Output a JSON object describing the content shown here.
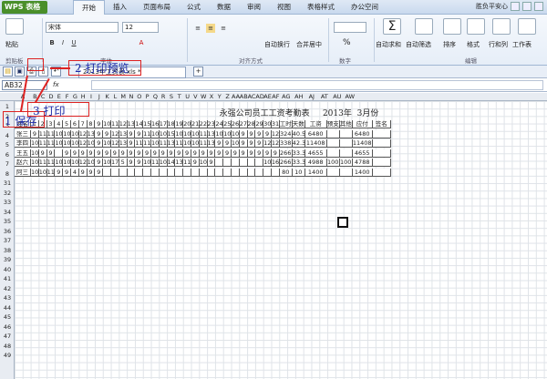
{
  "app": {
    "name": "WPS 表格"
  },
  "menu": [
    "开始",
    "插入",
    "页面布局",
    "公式",
    "数据",
    "审阅",
    "视图",
    "表格样式",
    "办公空间"
  ],
  "user": "胜负平安心",
  "ribbon": {
    "paste": "粘贴",
    "clipboard": "剪贴板",
    "font_name": "宋体",
    "font_size": "12",
    "font_group": "字体",
    "align_group": "对齐方式",
    "wrap": "自动换行",
    "merge": "合并居中",
    "number_group": "数字",
    "percent": "%",
    "autosum": "自动求和",
    "autofilter": "自动筛选",
    "sort": "排序",
    "format": "格式",
    "rowcol": "行和列",
    "worksheet": "工作表",
    "edit_group": "编辑"
  },
  "quickbar": {
    "file_tab": "2013年工资表.xls *",
    "plus": "+"
  },
  "formula": {
    "namebox": "AB32",
    "fx": "fx"
  },
  "columns": [
    "A",
    "B",
    "C",
    "D",
    "E",
    "F",
    "G",
    "H",
    "I",
    "J",
    "K",
    "L",
    "M",
    "N",
    "O",
    "P",
    "Q",
    "R",
    "S",
    "T",
    "U",
    "V",
    "W",
    "X",
    "Y",
    "Z",
    "AA",
    "AB",
    "AC",
    "AD",
    "AE",
    "AF",
    "AG",
    "AH",
    "AJ",
    "AT",
    "AU",
    "AW"
  ],
  "rows": [
    "1",
    "2",
    "3",
    "4",
    "5",
    "6",
    "7",
    "8",
    "31",
    "32",
    "33",
    "34",
    "35",
    "36",
    "37",
    "38",
    "39",
    "40",
    "41",
    "42",
    "43",
    "44",
    "45",
    "46",
    "47",
    "48",
    "49"
  ],
  "sheet": {
    "title": "永强公司员工工资考勤表     2013年  3月份",
    "header": [
      "姓名",
      "1",
      "2",
      "3",
      "4",
      "5",
      "6",
      "7",
      "8",
      "9",
      "10",
      "11",
      "12",
      "13",
      "14",
      "15",
      "16",
      "17",
      "18",
      "19",
      "20",
      "21",
      "22",
      "23",
      "24",
      "25",
      "26",
      "27",
      "28",
      "29",
      "30",
      "31",
      "工时",
      "天数",
      "工资",
      "预支",
      "其他",
      "应付",
      "签名"
    ],
    "data": [
      [
        "张三",
        "9",
        "11",
        "11",
        "10",
        "10",
        "10",
        "12",
        "13",
        "9",
        "9",
        "12",
        "13",
        "9",
        "9",
        "11",
        "10",
        "10",
        "15",
        "10",
        "10",
        "10",
        "11",
        "13",
        "10",
        "10",
        "10",
        "9",
        "9",
        "9",
        "9",
        "12",
        "324",
        "40.5",
        "6480",
        "",
        "",
        "6480",
        ""
      ],
      [
        "李四",
        "10",
        "11",
        "11",
        "10",
        "10",
        "10",
        "12",
        "10",
        "9",
        "10",
        "12",
        "13",
        "9",
        "11",
        "11",
        "10",
        "11",
        "13",
        "11",
        "10",
        "10",
        "11",
        "13",
        "9",
        "9",
        "10",
        "9",
        "9",
        "9",
        "12",
        "12",
        "338",
        "42.3",
        "11408",
        "",
        "",
        "11408",
        ""
      ],
      [
        "王五",
        "10",
        "9",
        "9",
        "",
        "9",
        "9",
        "9",
        "9",
        "9",
        "9",
        "9",
        "9",
        "9",
        "9",
        "9",
        "9",
        "9",
        "9",
        "9",
        "9",
        "9",
        "9",
        "9",
        "9",
        "9",
        "9",
        "9",
        "9",
        "9",
        "9",
        "9",
        "266",
        "33.3",
        "4655",
        "",
        "",
        "4655",
        ""
      ],
      [
        "赵六",
        "10",
        "11",
        "11",
        "10",
        "10",
        "10",
        "12",
        "10",
        "9",
        "10",
        "17",
        "5",
        "9",
        "9",
        "10",
        "11",
        "10",
        "14",
        "13",
        "11",
        "9",
        "10",
        "9",
        "",
        "",
        "",
        "",
        "",
        "",
        "10",
        "16",
        "266",
        "33.3",
        "4988",
        "100",
        "100",
        "4788",
        ""
      ],
      [
        "阿三",
        "10",
        "10",
        "11",
        "9",
        "9",
        "4",
        "9",
        "9",
        "9",
        "",
        "",
        "",
        "",
        "",
        "",
        "",
        "",
        "",
        "",
        "",
        "",
        "",
        "",
        "",
        "",
        "",
        "",
        "",
        "",
        "",
        "",
        "80",
        "10",
        "1400",
        "",
        "",
        "1400",
        ""
      ]
    ]
  },
  "annotations": {
    "a1": "1 保存",
    "a2": "2 打印预览",
    "a3": "3 打印"
  }
}
